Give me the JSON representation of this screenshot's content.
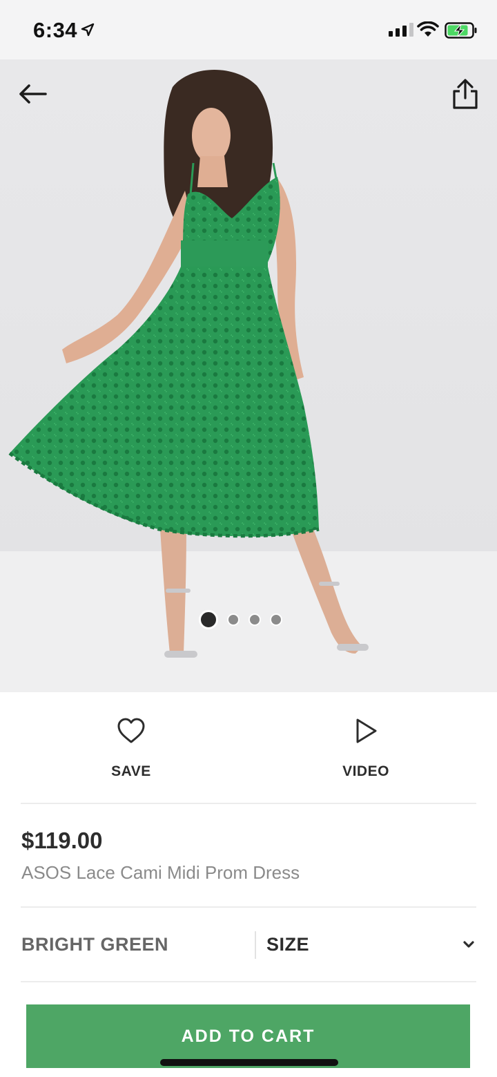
{
  "status_bar": {
    "time": "6:34",
    "icons": [
      "location-arrow-icon",
      "signal-icon",
      "wifi-icon",
      "battery-charging-icon"
    ]
  },
  "hero": {
    "image_description_icon": "product-photo-green-lace-dress",
    "carousel": {
      "total": 4,
      "active_index": 0
    },
    "nav_icons": [
      "back-arrow-icon",
      "share-icon"
    ]
  },
  "actions": {
    "save_label": "SAVE",
    "video_label": "VIDEO"
  },
  "product": {
    "price": "$119.00",
    "name": "ASOS Lace Cami Midi Prom Dress"
  },
  "options": {
    "colour": "BRIGHT GREEN",
    "size_label": "SIZE"
  },
  "cta": {
    "add_to_cart_label": "ADD TO CART"
  },
  "colors": {
    "accent": "#4ea665",
    "dress": "#2a9a56",
    "text": "#2d2d2d",
    "muted": "#8a8a8a"
  }
}
